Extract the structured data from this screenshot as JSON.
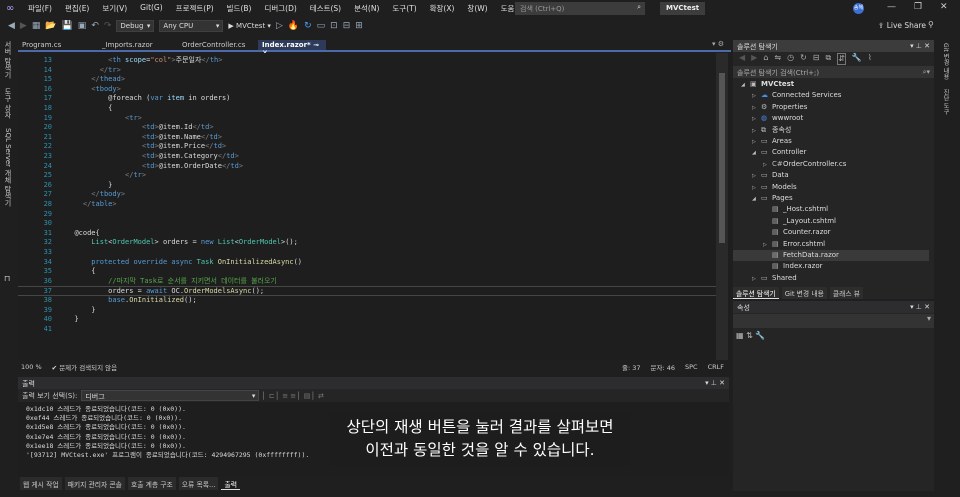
{
  "menu": [
    "파일(F)",
    "편집(E)",
    "보기(V)",
    "Git(G)",
    "프로젝트(P)",
    "빌드(B)",
    "디버그(D)",
    "테스트(S)",
    "분석(N)",
    "도구(T)",
    "확장(X)",
    "창(W)",
    "도움말(H)"
  ],
  "search": {
    "placeholder": "검색 (Ctrl+Q)"
  },
  "project_badge": "MVCtest",
  "avatar": "송해",
  "toolbar": {
    "config": "Debug",
    "platform": "Any CPU",
    "run": "MVCtest",
    "live_share": "Live Share"
  },
  "left_strip": [
    "서버 탐색기",
    "도구 상자",
    "SQL Server 개체 탐색기"
  ],
  "tabs": [
    {
      "label": "Program.cs"
    },
    {
      "label": "_Imports.razor"
    },
    {
      "label": "OrderController.cs"
    },
    {
      "label": "Index.razor*",
      "active": true
    }
  ],
  "code": [
    {
      "n": 13,
      "i": 10,
      "t": [
        [
          "<",
          "bracket"
        ],
        [
          "th ",
          "tag"
        ],
        [
          "scope",
          "attr"
        ],
        [
          "=",
          "plain"
        ],
        [
          "\"col\"",
          "str"
        ],
        [
          ">",
          "bracket"
        ],
        [
          "주문일자",
          "plain"
        ],
        [
          "</",
          "bracket"
        ],
        [
          "th",
          "tag"
        ],
        [
          ">",
          "bracket"
        ]
      ]
    },
    {
      "n": 14,
      "i": 8,
      "t": [
        [
          "</",
          "bracket"
        ],
        [
          "tr",
          "tag"
        ],
        [
          ">",
          "bracket"
        ]
      ]
    },
    {
      "n": 15,
      "i": 6,
      "t": [
        [
          "</",
          "bracket"
        ],
        [
          "thead",
          "tag"
        ],
        [
          ">",
          "bracket"
        ]
      ]
    },
    {
      "n": 16,
      "i": 6,
      "t": [
        [
          "<",
          "bracket"
        ],
        [
          "tbody",
          "tag"
        ],
        [
          ">",
          "bracket"
        ]
      ]
    },
    {
      "n": 17,
      "i": 10,
      "t": [
        [
          "@foreach (",
          "plain"
        ],
        [
          "var ",
          "kw"
        ],
        [
          "item ",
          "attr"
        ],
        [
          "in orders)",
          "plain"
        ]
      ]
    },
    {
      "n": 18,
      "i": 10,
      "t": [
        [
          "{",
          "plain"
        ]
      ]
    },
    {
      "n": 19,
      "i": 14,
      "t": [
        [
          "<",
          "bracket"
        ],
        [
          "tr",
          "tag"
        ],
        [
          ">",
          "bracket"
        ]
      ]
    },
    {
      "n": 20,
      "i": 18,
      "t": [
        [
          "<",
          "bracket"
        ],
        [
          "td",
          "tag"
        ],
        [
          ">",
          "bracket"
        ],
        [
          "@item.Id",
          "plain"
        ],
        [
          "</",
          "bracket"
        ],
        [
          "td",
          "tag"
        ],
        [
          ">",
          "bracket"
        ]
      ]
    },
    {
      "n": 21,
      "i": 18,
      "t": [
        [
          "<",
          "bracket"
        ],
        [
          "td",
          "tag"
        ],
        [
          ">",
          "bracket"
        ],
        [
          "@item.Name",
          "plain"
        ],
        [
          "</",
          "bracket"
        ],
        [
          "td",
          "tag"
        ],
        [
          ">",
          "bracket"
        ]
      ]
    },
    {
      "n": 22,
      "i": 18,
      "t": [
        [
          "<",
          "bracket"
        ],
        [
          "td",
          "tag"
        ],
        [
          ">",
          "bracket"
        ],
        [
          "@item.Price",
          "plain"
        ],
        [
          "</",
          "bracket"
        ],
        [
          "td",
          "tag"
        ],
        [
          ">",
          "bracket"
        ]
      ]
    },
    {
      "n": 23,
      "i": 18,
      "t": [
        [
          "<",
          "bracket"
        ],
        [
          "td",
          "tag"
        ],
        [
          ">",
          "bracket"
        ],
        [
          "@item.Category",
          "plain"
        ],
        [
          "</",
          "bracket"
        ],
        [
          "td",
          "tag"
        ],
        [
          ">",
          "bracket"
        ]
      ]
    },
    {
      "n": 24,
      "i": 18,
      "t": [
        [
          "<",
          "bracket"
        ],
        [
          "td",
          "tag"
        ],
        [
          ">",
          "bracket"
        ],
        [
          "@item.OrderDate",
          "plain"
        ],
        [
          "</",
          "bracket"
        ],
        [
          "td",
          "tag"
        ],
        [
          ">",
          "bracket"
        ]
      ]
    },
    {
      "n": 25,
      "i": 14,
      "t": [
        [
          "</",
          "bracket"
        ],
        [
          "tr",
          "tag"
        ],
        [
          ">",
          "bracket"
        ]
      ]
    },
    {
      "n": 26,
      "i": 10,
      "t": [
        [
          "}",
          "plain"
        ]
      ]
    },
    {
      "n": 27,
      "i": 6,
      "t": [
        [
          "</",
          "bracket"
        ],
        [
          "tbody",
          "tag"
        ],
        [
          ">",
          "bracket"
        ]
      ]
    },
    {
      "n": 28,
      "i": 4,
      "t": [
        [
          "</",
          "bracket"
        ],
        [
          "table",
          "tag"
        ],
        [
          ">",
          "bracket"
        ]
      ]
    },
    {
      "n": 29,
      "i": 0,
      "t": []
    },
    {
      "n": 30,
      "i": 0,
      "t": []
    },
    {
      "n": 31,
      "i": 2,
      "t": [
        [
          "@code{",
          "plain"
        ]
      ]
    },
    {
      "n": 32,
      "i": 6,
      "t": [
        [
          "List",
          "type"
        ],
        [
          "<",
          "plain"
        ],
        [
          "OrderModel",
          "type"
        ],
        [
          "> orders = ",
          "plain"
        ],
        [
          "new ",
          "kw"
        ],
        [
          "List",
          "type"
        ],
        [
          "<",
          "plain"
        ],
        [
          "OrderModel",
          "type"
        ],
        [
          ">();",
          "plain"
        ]
      ]
    },
    {
      "n": 33,
      "i": 0,
      "t": []
    },
    {
      "n": 34,
      "i": 6,
      "t": [
        [
          "protected override async ",
          "kw"
        ],
        [
          "Task ",
          "type"
        ],
        [
          "OnInitializedAsync",
          "method"
        ],
        [
          "()",
          "plain"
        ]
      ]
    },
    {
      "n": 35,
      "i": 6,
      "t": [
        [
          "{",
          "plain"
        ]
      ]
    },
    {
      "n": 36,
      "i": 10,
      "t": [
        [
          "//마지막 Task로 순서를 지키면서 데이터를 불러오기",
          "comment"
        ]
      ]
    },
    {
      "n": 37,
      "i": 10,
      "t": [
        [
          "orders = ",
          "plain"
        ],
        [
          "await ",
          "kw"
        ],
        [
          "OC.",
          "plain"
        ],
        [
          "OrderModelsAsync",
          "method"
        ],
        [
          "();",
          "plain"
        ]
      ],
      "current": true
    },
    {
      "n": 38,
      "i": 10,
      "t": [
        [
          "base",
          "kw"
        ],
        [
          ".",
          "plain"
        ],
        [
          "OnInitialized",
          "method"
        ],
        [
          "();",
          "plain"
        ]
      ]
    },
    {
      "n": 39,
      "i": 6,
      "t": [
        [
          "}",
          "plain"
        ]
      ]
    },
    {
      "n": 40,
      "i": 2,
      "t": [
        [
          "}",
          "plain"
        ]
      ]
    },
    {
      "n": 41,
      "i": 0,
      "t": []
    }
  ],
  "editor_status": {
    "zoom": "100 %",
    "issues": "문제가 검색되지 않음",
    "line": "줄: 37",
    "col": "문자: 46",
    "spc": "SPC",
    "crlf": "CRLF"
  },
  "output": {
    "title": "출력",
    "select_label": "출력 보기 선택(S):",
    "select_value": "디버그",
    "lines": [
      "0x1dc10 스레드가 종료되었습니다(코드: 0 (0x0)).",
      "0xef44 스레드가 종료되었습니다(코드: 0 (0x0)).",
      "0x1d5e8 스레드가 종료되었습니다(코드: 0 (0x0)).",
      "0x1e7e4 스레드가 종료되었습니다(코드: 0 (0x0)).",
      "0x1ee18 스레드가 종료되었습니다(코드: 0 (0x0)).",
      "'[93712] MVCtest.exe' 프로그램이 종료되었습니다(코드: 4294967295 (0xffffffff))."
    ]
  },
  "bottom_tabs": [
    {
      "label": "웹 게시 작업"
    },
    {
      "label": "패키지 관리자 콘솔"
    },
    {
      "label": "호출 계층 구조"
    },
    {
      "label": "오류 목록..."
    },
    {
      "label": "출력",
      "active": true
    }
  ],
  "subtitle": [
    "상단의 재생 버튼을 눌러 결과를 살펴보면",
    "이전과 동일한 것을 알 수 있습니다."
  ],
  "solution_explorer": {
    "title": "솔루션 탐색기",
    "search_placeholder": "솔루션 탐색기 검색(Ctrl+;)",
    "tree": [
      {
        "label": "MVCtest",
        "level": 0,
        "arrow": "◢",
        "icon": "▣",
        "bold": true
      },
      {
        "label": "Connected Services",
        "level": 1,
        "arrow": "▷",
        "icon": "☁"
      },
      {
        "label": "Properties",
        "level": 1,
        "arrow": "▷",
        "icon": "⚙"
      },
      {
        "label": "wwwroot",
        "level": 1,
        "arrow": "▷",
        "icon": "◍"
      },
      {
        "label": "종속성",
        "level": 1,
        "arrow": "▷",
        "icon": "⧉"
      },
      {
        "label": "Areas",
        "level": 1,
        "arrow": "▷",
        "icon": "▭"
      },
      {
        "label": "Controller",
        "level": 1,
        "arrow": "◢",
        "icon": "▭"
      },
      {
        "label": "OrderController.cs",
        "level": 2,
        "arrow": "▷",
        "icon": "C#"
      },
      {
        "label": "Data",
        "level": 1,
        "arrow": "▷",
        "icon": "▭"
      },
      {
        "label": "Models",
        "level": 1,
        "arrow": "▷",
        "icon": "▭"
      },
      {
        "label": "Pages",
        "level": 1,
        "arrow": "◢",
        "icon": "▭"
      },
      {
        "label": "_Host.cshtml",
        "level": 2,
        "arrow": "",
        "icon": "▤"
      },
      {
        "label": "_Layout.cshtml",
        "level": 2,
        "arrow": "",
        "icon": "▤"
      },
      {
        "label": "Counter.razor",
        "level": 2,
        "arrow": "",
        "icon": "▤"
      },
      {
        "label": "Error.cshtml",
        "level": 2,
        "arrow": "▷",
        "icon": "▤"
      },
      {
        "label": "FetchData.razor",
        "level": 2,
        "arrow": "",
        "icon": "▤",
        "selected": true
      },
      {
        "label": "Index.razor",
        "level": 2,
        "arrow": "",
        "icon": "▤"
      },
      {
        "label": "Shared",
        "level": 1,
        "arrow": "▷",
        "icon": "▭"
      }
    ],
    "tabs": [
      {
        "label": "솔루션 탐색기",
        "active": true
      },
      {
        "label": "Git 변경 내용"
      },
      {
        "label": "클래스 뷰"
      }
    ]
  },
  "properties": {
    "title": "속성"
  },
  "right_strip": [
    "Git 변경 내용",
    "진단 도구"
  ]
}
